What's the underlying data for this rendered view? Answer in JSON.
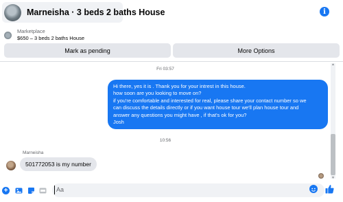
{
  "header": {
    "title": "Marneisha · 3 beds 2 baths House",
    "info_icon": "info-icon",
    "info_glyph": "i"
  },
  "listing": {
    "label": "Marketplace",
    "description": "$650 – 3 beds 2 baths House"
  },
  "actions": {
    "pending_label": "Mark as pending",
    "more_label": "More Options"
  },
  "conversation": {
    "timestamp_1": "Fri 03:57",
    "outgoing_lines": [
      "Hi there, yes it is . Thank you for your intrest in this house.",
      "how soon are you looking to move on?",
      "if you're comfortable and interested for real, please share your contact number so we",
      "can discuss the details directly or if you  want house tour we'll plan house tour and",
      "answer any questions you might have , if that's ok for you?",
      "Josh"
    ],
    "timestamp_2": "10:56",
    "sender_name": "Marneisha",
    "incoming_message": "501772053 is my number"
  },
  "composer": {
    "plus_glyph": "+",
    "placeholder": "Aa",
    "icons": [
      "plus-icon",
      "image-icon",
      "sticker-icon",
      "gif-icon",
      "emoji-icon",
      "like-icon"
    ]
  },
  "colors": {
    "accent": "#1877f2",
    "bubble_in": "#e4e6eb",
    "button_bg": "#e4e6eb",
    "muted_text": "#65676b"
  }
}
